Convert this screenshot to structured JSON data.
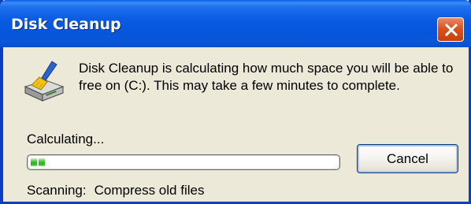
{
  "window": {
    "title": "Disk Cleanup",
    "close_icon": "close-icon",
    "title_bar_color": "#0a5ce2"
  },
  "message": {
    "text": "Disk Cleanup is calculating how much space you will be able to free on  (C:). This may take a few minutes to complete.",
    "icon": "disk-cleanup-icon"
  },
  "progress": {
    "label": "Calculating...",
    "value": 0.05,
    "color": "#38c22a"
  },
  "buttons": {
    "cancel_label": "Cancel"
  },
  "scan": {
    "label": "Scanning:",
    "item": "Compress old files"
  }
}
